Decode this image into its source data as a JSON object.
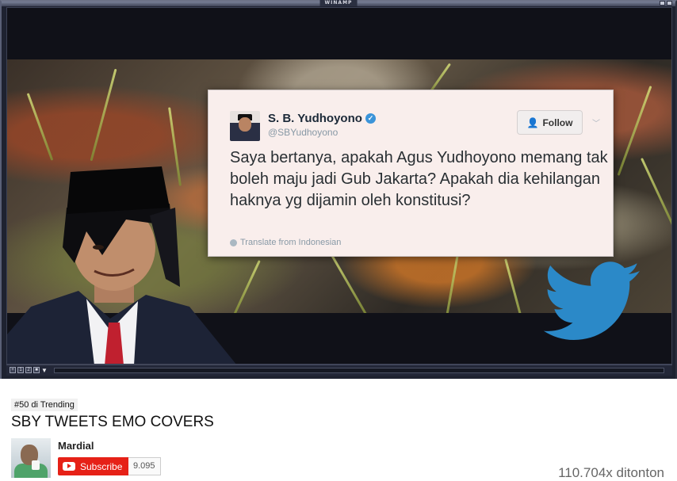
{
  "player": {
    "title": "WINAMP"
  },
  "tweet": {
    "name": "S. B. Yudhoyono",
    "verified_icon": "verified-badge-icon",
    "handle": "@SBYudhoyono",
    "follow_label": "Follow",
    "text": "Saya bertanya, apakah Agus Yudhoyono memang tak boleh maju jadi Gub Jakarta? Apakah dia kehilangan haknya yg dijamin oleh konstitusi?",
    "translate_label": "Translate from Indonesian"
  },
  "video": {
    "trending_badge": "#50 di Trending",
    "title": "SBY TWEETS EMO COVERS",
    "channel_name": "Mardial",
    "subscribe_label": "Subscribe",
    "subscriber_count": "9.095",
    "views": "110.704x ditonton"
  },
  "colors": {
    "subscribe_red": "#e62117",
    "twitter_blue": "#3b94d9",
    "winamp_frame": "#1e2230"
  }
}
